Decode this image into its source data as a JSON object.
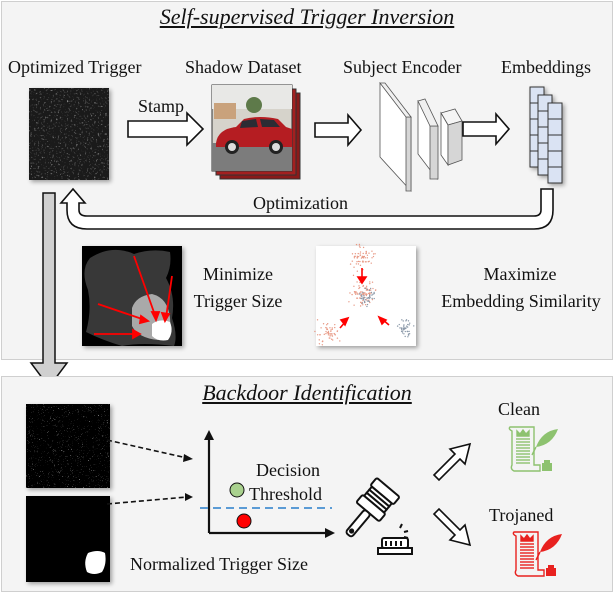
{
  "top_section": {
    "title": "Self-supervised Trigger Inversion",
    "labels": {
      "optimized_trigger": "Optimized Trigger",
      "shadow_dataset": "Shadow Dataset",
      "subject_encoder": "Subject Encoder",
      "embeddings": "Embeddings",
      "stamp": "Stamp",
      "optimization": "Optimization",
      "minimize_line1": "Minimize",
      "minimize_line2": "Trigger Size",
      "maximize_line1": "Maximize",
      "maximize_line2": "Embedding Similarity"
    }
  },
  "bottom_section": {
    "title": "Backdoor Identification",
    "labels": {
      "decision_line1": "Decision",
      "decision_line2": "Threshold",
      "x_axis": "Normalized Trigger Size",
      "clean": "Clean",
      "trojaned": "Trojaned"
    }
  },
  "colors": {
    "panel_bg": "#f4f4f4",
    "clean_green": "#8dc26f",
    "trojan_red": "#e8211f",
    "threshold_blue": "#5b9bd5",
    "embedding_fill": "#dae3f3",
    "arrow_red": "#ff0000"
  }
}
